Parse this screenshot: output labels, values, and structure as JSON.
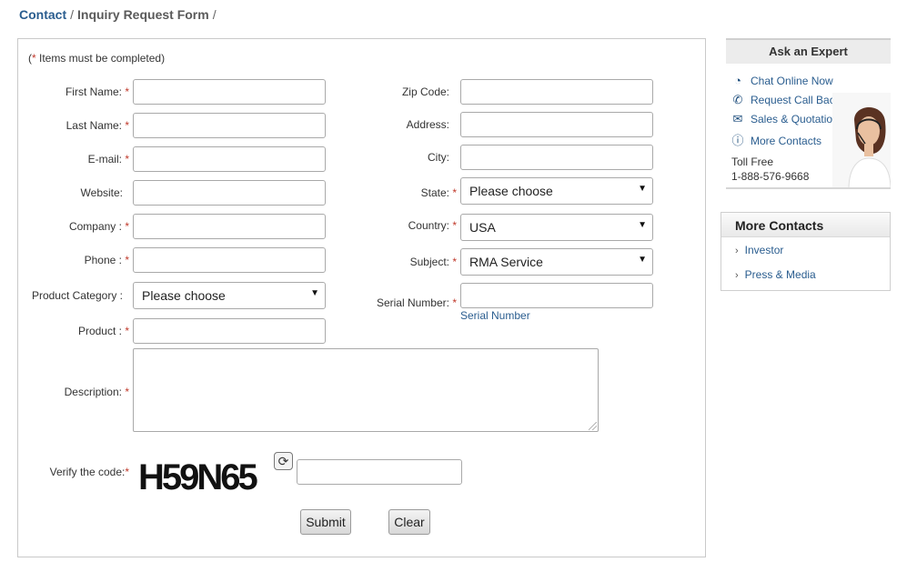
{
  "breadcrumb": {
    "contact": "Contact",
    "current": "Inquiry Request Form",
    "sep1": "/",
    "sep2": "/"
  },
  "form": {
    "required_note_open": "(",
    "required_note_star": "*",
    "required_note_text": " Items must be completed)",
    "required_mark": "*",
    "left": {
      "first_name": "First Name:",
      "last_name": "Last Name:",
      "email": "E-mail:",
      "website": "Website:",
      "company": "Company :",
      "phone": "Phone :",
      "product_category": "Product Category :",
      "product_category_value": "Please choose",
      "product": "Product :",
      "description": "Description:"
    },
    "right": {
      "zip": "Zip Code:",
      "address": "Address:",
      "city": "City:",
      "state": "State:",
      "state_value": "Please choose",
      "country": "Country:",
      "country_value": "USA",
      "subject": "Subject:",
      "subject_value": "RMA Service",
      "serial": "Serial Number:",
      "serial_link": "Serial Number"
    },
    "verify_label": "Verify the code:",
    "captcha_code": "H59N65",
    "submit": "Submit",
    "clear": "Clear"
  },
  "expert": {
    "title": "Ask an Expert",
    "items": [
      {
        "label": "Chat Online Now",
        "icon": "chat-icon"
      },
      {
        "label": "Request Call Back",
        "icon": "phone-icon"
      },
      {
        "label": "Sales & Quotation",
        "icon": "envelope-icon"
      },
      {
        "label": "More Contacts",
        "icon": "info-icon"
      }
    ],
    "toll_label": "Toll Free",
    "toll_number": "1-888-576-9668"
  },
  "more_contacts": {
    "title": "More Contacts",
    "items": [
      "Investor",
      "Press & Media"
    ]
  },
  "colors": {
    "link": "#2a5d8f",
    "required": "#c0392b"
  }
}
